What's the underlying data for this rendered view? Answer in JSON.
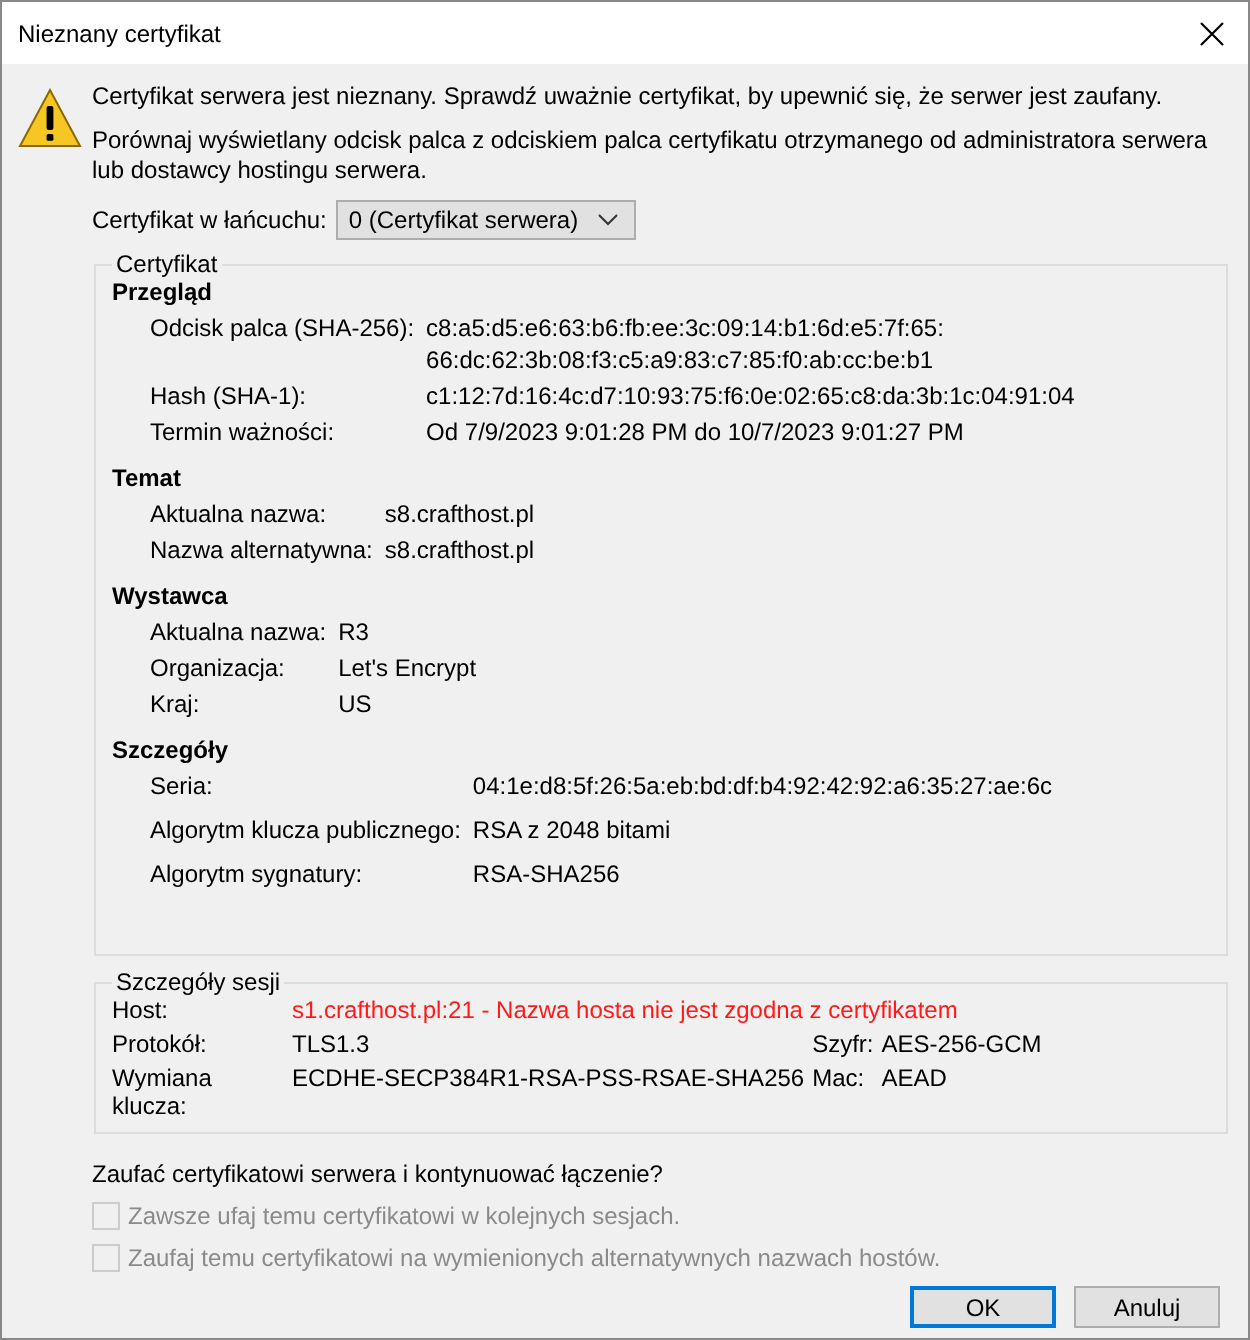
{
  "window": {
    "title": "Nieznany certyfikat"
  },
  "message": [
    "Certyfikat serwera jest nieznany. Sprawdź uważnie certyfikat, by upewnić się, że serwer jest zaufany.",
    "Porównaj wyświetlany odcisk palca z odciskiem palca certyfikatu otrzymanego od administratora serwera lub dostawcy hostingu serwera."
  ],
  "chain": {
    "label": "Certyfikat w łańcuchu:",
    "value": "0 (Certyfikat serwera)"
  },
  "certificate": {
    "title": "Certyfikat",
    "sections": [
      {
        "heading": "Przegląd",
        "rows": [
          {
            "label": "Odcisk palca (SHA-256):",
            "values": [
              "c8:a5:d5:e6:63:b6:fb:ee:3c:09:14:b1:6d:e5:7f:65:",
              "66:dc:62:3b:08:f3:c5:a9:83:c7:85:f0:ab:cc:be:b1"
            ]
          },
          {
            "label": "Hash (SHA-1):",
            "values": [
              "c1:12:7d:16:4c:d7:10:93:75:f6:0e:02:65:c8:da:3b:1c:04:91:04"
            ]
          },
          {
            "label": "Termin ważności:",
            "values": [
              "Od 7/9/2023 9:01:28 PM do 10/7/2023 9:01:27 PM"
            ]
          }
        ]
      },
      {
        "heading": "Temat",
        "rows": [
          {
            "label": "Aktualna nazwa:",
            "values": [
              "s8.crafthost.pl"
            ]
          },
          {
            "label": "Nazwa alternatywna:",
            "values": [
              "s8.crafthost.pl"
            ]
          }
        ]
      },
      {
        "heading": "Wystawca",
        "rows": [
          {
            "label": "Aktualna nazwa:",
            "values": [
              "R3"
            ]
          },
          {
            "label": "Organizacja:",
            "values": [
              "Let's Encrypt"
            ]
          },
          {
            "label": "Kraj:",
            "values": [
              "US"
            ]
          }
        ]
      },
      {
        "heading": "Szczegóły",
        "rows": [
          {
            "label": "Seria:",
            "values": [
              "04:1e:d8:5f:26:5a:eb:bd:df:b4:92:42:92:a6:35:27:ae:6c"
            ]
          },
          {
            "label": "Algorytm klucza publicznego:",
            "values": [
              "RSA z 2048 bitami"
            ]
          },
          {
            "label": "Algorytm sygnatury:",
            "values": [
              "RSA-SHA256"
            ]
          }
        ]
      }
    ]
  },
  "session": {
    "title": "Szczegóły sesji",
    "host": {
      "label": "Host:",
      "value": "s1.crafthost.pl:21 - Nazwa hosta nie jest zgodna z certyfikatem",
      "error": true
    },
    "rows": [
      {
        "label": "Protokół:",
        "value": "TLS1.3",
        "extra_label": "Szyfr:",
        "extra_value": "AES-256-GCM"
      },
      {
        "label": "Wymiana klucza:",
        "value": "ECDHE-SECP384R1-RSA-PSS-RSAE-SHA256",
        "extra_label": "Mac:",
        "extra_value": "AEAD"
      }
    ]
  },
  "question": "Zaufać certyfikatowi serwera i kontynuować łączenie?",
  "checkboxes": [
    {
      "label": "Zawsze ufaj temu certyfikatowi w kolejnych sesjach.",
      "checked": false,
      "disabled": true
    },
    {
      "label": "Zaufaj temu certyfikatowi na wymienionych alternatywnych nazwach hostów.",
      "checked": false,
      "disabled": true
    }
  ],
  "buttons": [
    {
      "label": "OK",
      "default": true
    },
    {
      "label": "Anuluj",
      "default": false
    }
  ]
}
